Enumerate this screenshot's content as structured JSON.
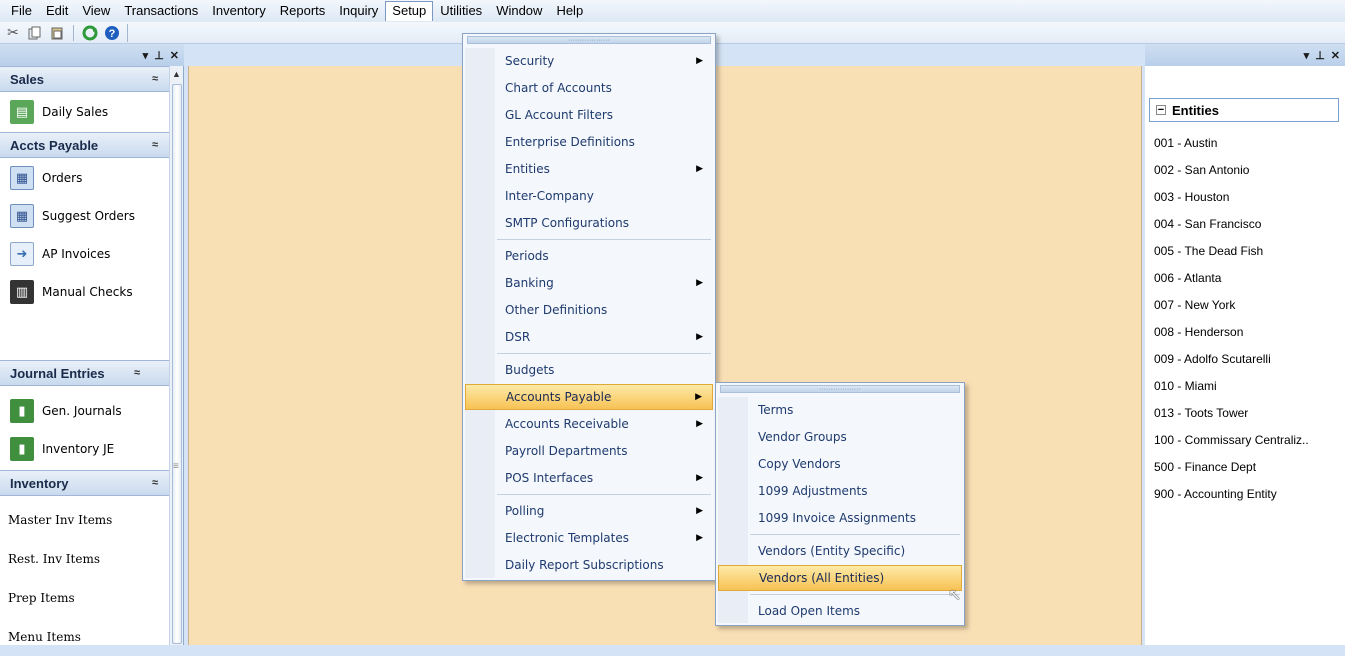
{
  "menubar": {
    "items": [
      "File",
      "Edit",
      "View",
      "Transactions",
      "Inventory",
      "Reports",
      "Inquiry",
      "Setup",
      "Utilities",
      "Window",
      "Help"
    ]
  },
  "toolbar": {
    "icons": [
      "scissors-icon",
      "copy-icon",
      "paste-icon",
      "refresh-icon",
      "help-icon"
    ]
  },
  "left_panel": {
    "sections": [
      {
        "title": "Sales",
        "items": [
          {
            "label": "Daily Sales",
            "icon": "daily-sales-icon"
          }
        ]
      },
      {
        "title": "Accts Payable",
        "items": [
          {
            "label": "Orders",
            "icon": "orders-icon"
          },
          {
            "label": "Suggest Orders",
            "icon": "suggest-orders-icon"
          },
          {
            "label": "AP Invoices",
            "icon": "ap-invoices-icon"
          },
          {
            "label": "Manual Checks",
            "icon": "manual-checks-icon"
          }
        ]
      },
      {
        "title": "Journal Entries",
        "items": [
          {
            "label": "Gen. Journals",
            "icon": "gen-journals-icon"
          },
          {
            "label": "Inventory JE",
            "icon": "inventory-je-icon"
          }
        ]
      },
      {
        "title": "Inventory",
        "items": [
          {
            "label": "Master Inv Items"
          },
          {
            "label": "Rest. Inv Items"
          },
          {
            "label": "Prep Items"
          },
          {
            "label": "Menu Items"
          }
        ]
      }
    ]
  },
  "setup_menu": {
    "items": [
      {
        "label": "Security",
        "submenu": true
      },
      {
        "label": "Chart of Accounts"
      },
      {
        "label": "GL Account Filters"
      },
      {
        "label": "Enterprise Definitions"
      },
      {
        "label": "Entities",
        "submenu": true
      },
      {
        "label": "Inter-Company"
      },
      {
        "label": "SMTP Configurations"
      },
      {
        "label": "Periods"
      },
      {
        "label": "Banking",
        "submenu": true
      },
      {
        "label": "Other Definitions"
      },
      {
        "label": "DSR",
        "submenu": true
      },
      {
        "label": "Budgets"
      },
      {
        "label": "Accounts Payable",
        "submenu": true,
        "highlighted": true
      },
      {
        "label": "Accounts Receivable",
        "submenu": true
      },
      {
        "label": "Payroll Departments"
      },
      {
        "label": "POS Interfaces",
        "submenu": true
      },
      {
        "label": "Polling",
        "submenu": true
      },
      {
        "label": "Electronic Templates",
        "submenu": true
      },
      {
        "label": "Daily Report Subscriptions"
      }
    ]
  },
  "ap_submenu": {
    "items": [
      {
        "label": "Terms"
      },
      {
        "label": "Vendor Groups"
      },
      {
        "label": "Copy Vendors"
      },
      {
        "label": "1099 Adjustments"
      },
      {
        "label": "1099 Invoice Assignments"
      },
      {
        "label": "Vendors (Entity Specific)"
      },
      {
        "label": "Vendors (All Entities)",
        "highlighted": true
      },
      {
        "label": "Load Open Items"
      }
    ]
  },
  "right_panel": {
    "header": "Entities",
    "entities": [
      "001 - Austin",
      "002 - San Antonio",
      "003 - Houston",
      "004 - San Francisco",
      "005 - The Dead Fish",
      "006 - Atlanta",
      "007 - New York",
      "008 - Henderson",
      "009 - Adolfo Scutarelli",
      "010 - Miami",
      "013 - Toots Tower",
      "100 - Commissary Centraliz..",
      "500 - Finance Dept",
      "900 - Accounting Entity"
    ]
  },
  "colors": {
    "workspace": "#f9dfb4",
    "highlight": "#f7c254",
    "menu_text": "#1e3a6e"
  }
}
